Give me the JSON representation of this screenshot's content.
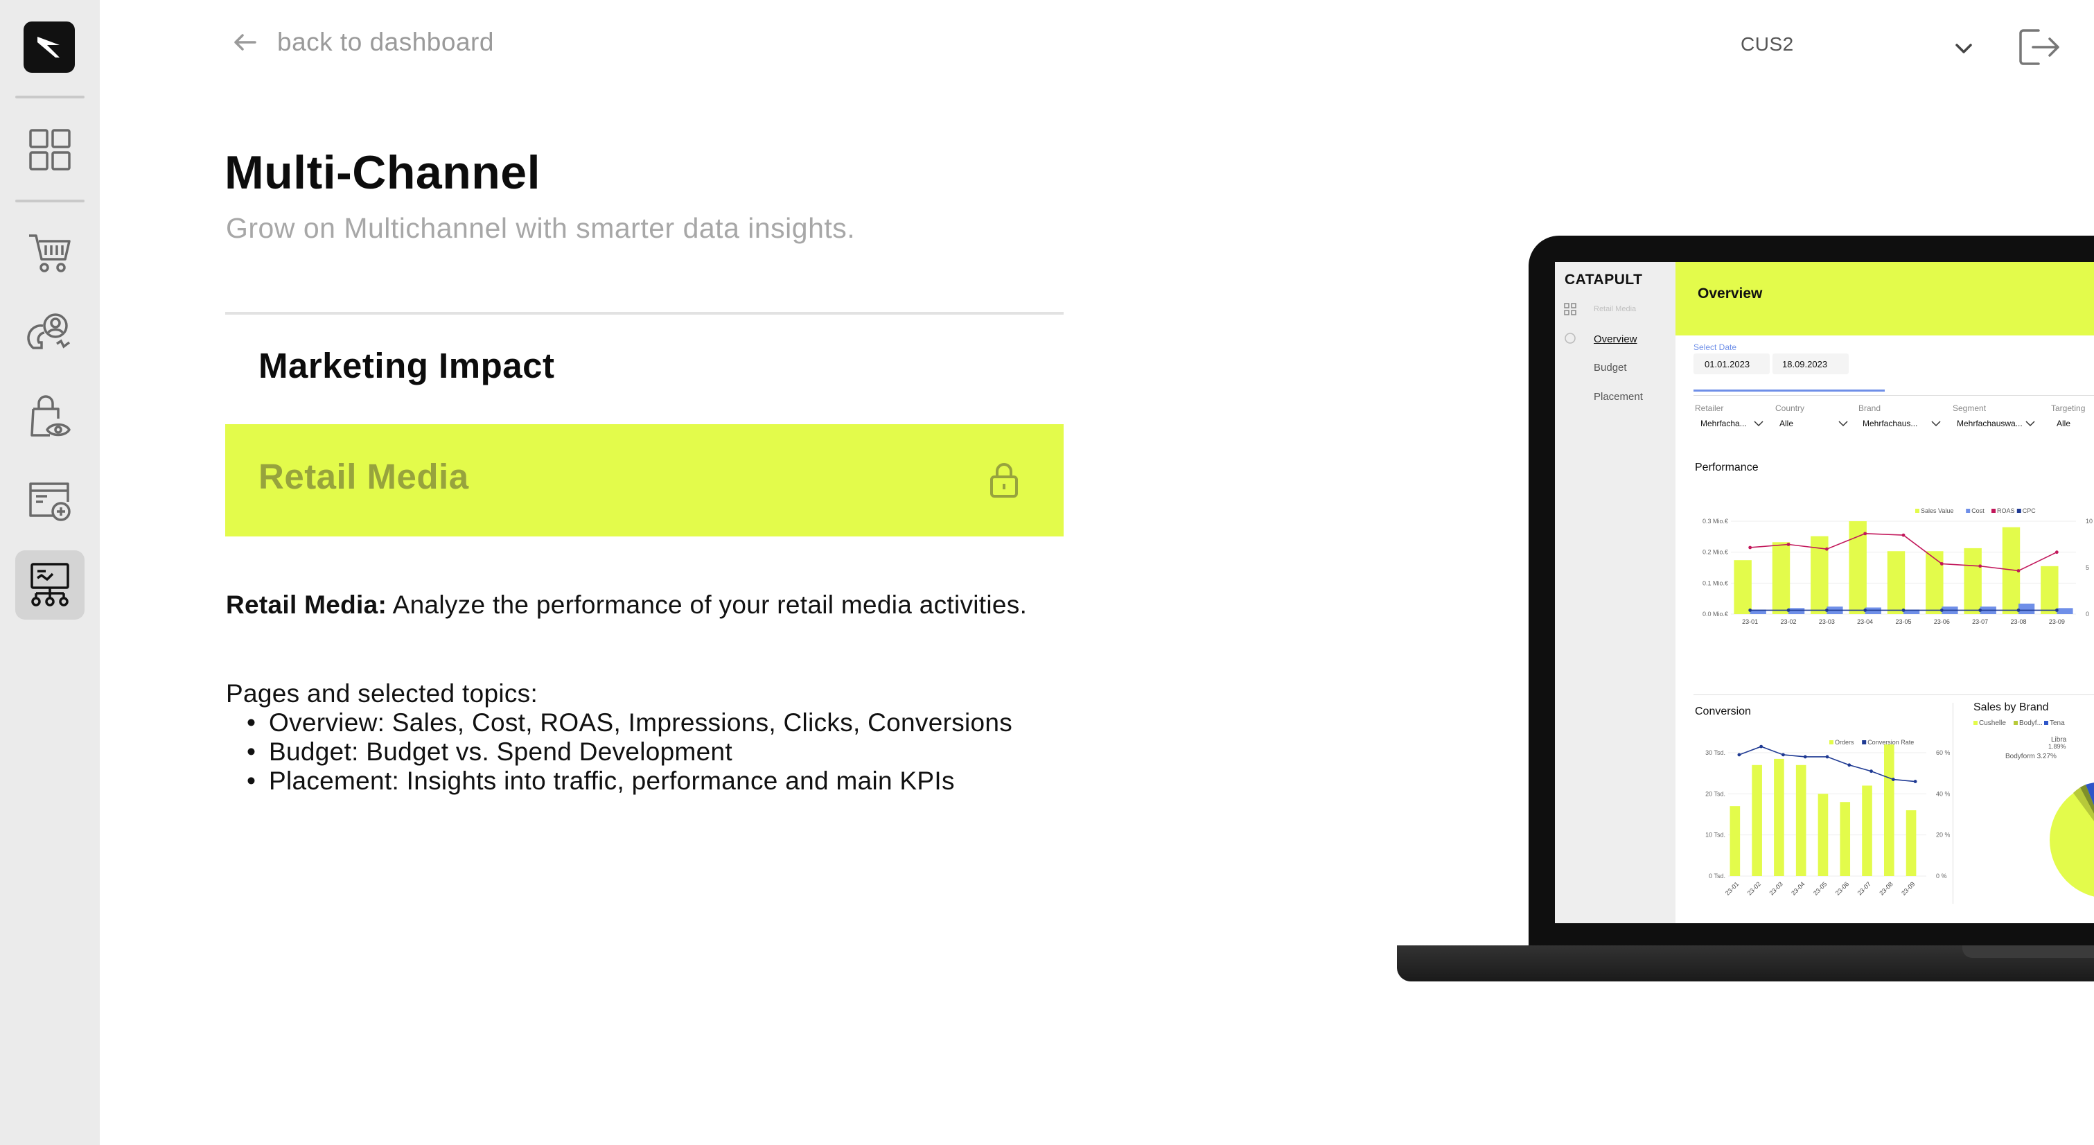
{
  "sidebar": {
    "logo_icon": "catapult-logo-icon",
    "items": [
      {
        "icon": "grid-dashboard-icon"
      },
      {
        "icon": "shopping-cart-icon"
      },
      {
        "icon": "customer-magnet-icon"
      },
      {
        "icon": "shopping-bag-eye-icon"
      },
      {
        "icon": "browser-add-icon"
      },
      {
        "icon": "presentation-network-icon",
        "active": true
      }
    ]
  },
  "header": {
    "back_label": "back to dashboard",
    "org_selector": "CUS2"
  },
  "main": {
    "title": "Multi-Channel",
    "subtitle": "Grow on Multichannel with smarter data insights.",
    "section_label": "Marketing Impact",
    "active_item": {
      "label": "Retail Media",
      "locked": true
    },
    "description_label": "Retail Media:",
    "description_text": " Analyze the performance of your retail media activities.",
    "pages_title": "Pages and selected topics:",
    "pages": [
      "Overview: Sales, Cost, ROAS, Impressions, Clicks, Conversions",
      "Budget: Budget vs. Spend Development",
      "Placement: Insights into traffic, performance and main KPIs"
    ]
  },
  "colors": {
    "accent": "#e3fb4b",
    "accent_text": "#97a33d",
    "rail_bg": "#ebebeb",
    "muted_text": "#a7a7a7",
    "chart_cost": "#6f8fe8",
    "chart_roas": "#c2185b",
    "chart_cpc": "#1f3a93"
  },
  "preview": {
    "logo": "CATAPULT",
    "side_heading": "Retail Media",
    "nav": [
      "Overview",
      "Budget",
      "Placement"
    ],
    "header": "Overview",
    "select_date_label": "Select Date",
    "date_from": "01.01.2023",
    "date_to": "18.09.2023",
    "filters": [
      {
        "label": "Retailer",
        "value": "Mehrfacha..."
      },
      {
        "label": "Country",
        "value": "Alle"
      },
      {
        "label": "Brand",
        "value": "Mehrfachaus..."
      },
      {
        "label": "Segment",
        "value": "Mehrfachauswa..."
      },
      {
        "label": "Targeting",
        "value": "Alle"
      }
    ],
    "performance_title": "Performance",
    "conversion_title": "Conversion",
    "sales_by_brand_title": "Sales by Brand",
    "pie_labels": {
      "legend_1": "Cushelle",
      "legend_2": "Bodyf...",
      "legend_3": "Tena",
      "l1": "Libra",
      "l1v": "1.89%",
      "l2": "Bodyform 3.27%"
    }
  },
  "chart_data": [
    {
      "type": "bar",
      "title": "Performance",
      "categories": [
        "23-01",
        "23-02",
        "23-03",
        "23-04",
        "23-05",
        "23-06",
        "23-07",
        "23-08",
        "23-09"
      ],
      "y_ticks": [
        "0.3 Mio.€",
        "0.2 Mio.€",
        "0.1 Mio.€",
        "0.0 Mio.€"
      ],
      "y2_ticks": [
        "10",
        "5",
        "0"
      ],
      "ylim": [
        0,
        0.31
      ],
      "y2lim": [
        0,
        12
      ],
      "legend": [
        "Sales Value",
        "Cost",
        "ROAS",
        "CPC"
      ],
      "series": [
        {
          "name": "Sales Value",
          "type": "bar",
          "values": [
            0.18,
            0.24,
            0.26,
            0.31,
            0.21,
            0.21,
            0.22,
            0.29,
            0.16
          ]
        },
        {
          "name": "Cost",
          "type": "bar",
          "values": [
            0.015,
            0.02,
            0.025,
            0.022,
            0.015,
            0.025,
            0.025,
            0.035,
            0.02
          ]
        },
        {
          "name": "ROAS",
          "type": "line",
          "values": [
            8.6,
            9.0,
            8.4,
            10.4,
            10.2,
            6.5,
            6.2,
            5.6,
            8.0
          ]
        },
        {
          "name": "CPC",
          "type": "line",
          "values": [
            0.5,
            0.5,
            0.5,
            0.5,
            0.5,
            0.5,
            0.5,
            0.5,
            0.5
          ]
        }
      ],
      "legend_position": "top-right"
    },
    {
      "type": "bar",
      "title": "Conversion",
      "categories": [
        "23-01",
        "23-02",
        "23-03",
        "23-04",
        "23-05",
        "23-06",
        "23-07",
        "23-08",
        "23-09"
      ],
      "y_ticks": [
        "30 Tsd.",
        "20 Tsd.",
        "10 Tsd.",
        "0 Tsd."
      ],
      "y2_ticks": [
        "60 %",
        "40 %",
        "20 %",
        "0 %"
      ],
      "ylim": [
        0,
        30
      ],
      "y2lim": [
        0,
        60
      ],
      "legend": [
        "Orders",
        "Conversion Rate"
      ],
      "series": [
        {
          "name": "Orders",
          "type": "bar",
          "values": [
            17,
            27,
            28.5,
            27,
            20,
            18,
            22,
            32,
            16
          ]
        },
        {
          "name": "Conversion Rate",
          "type": "line",
          "values": [
            59,
            63,
            59,
            58,
            58,
            54,
            51,
            47,
            46
          ]
        }
      ],
      "legend_position": "top-right"
    }
  ]
}
